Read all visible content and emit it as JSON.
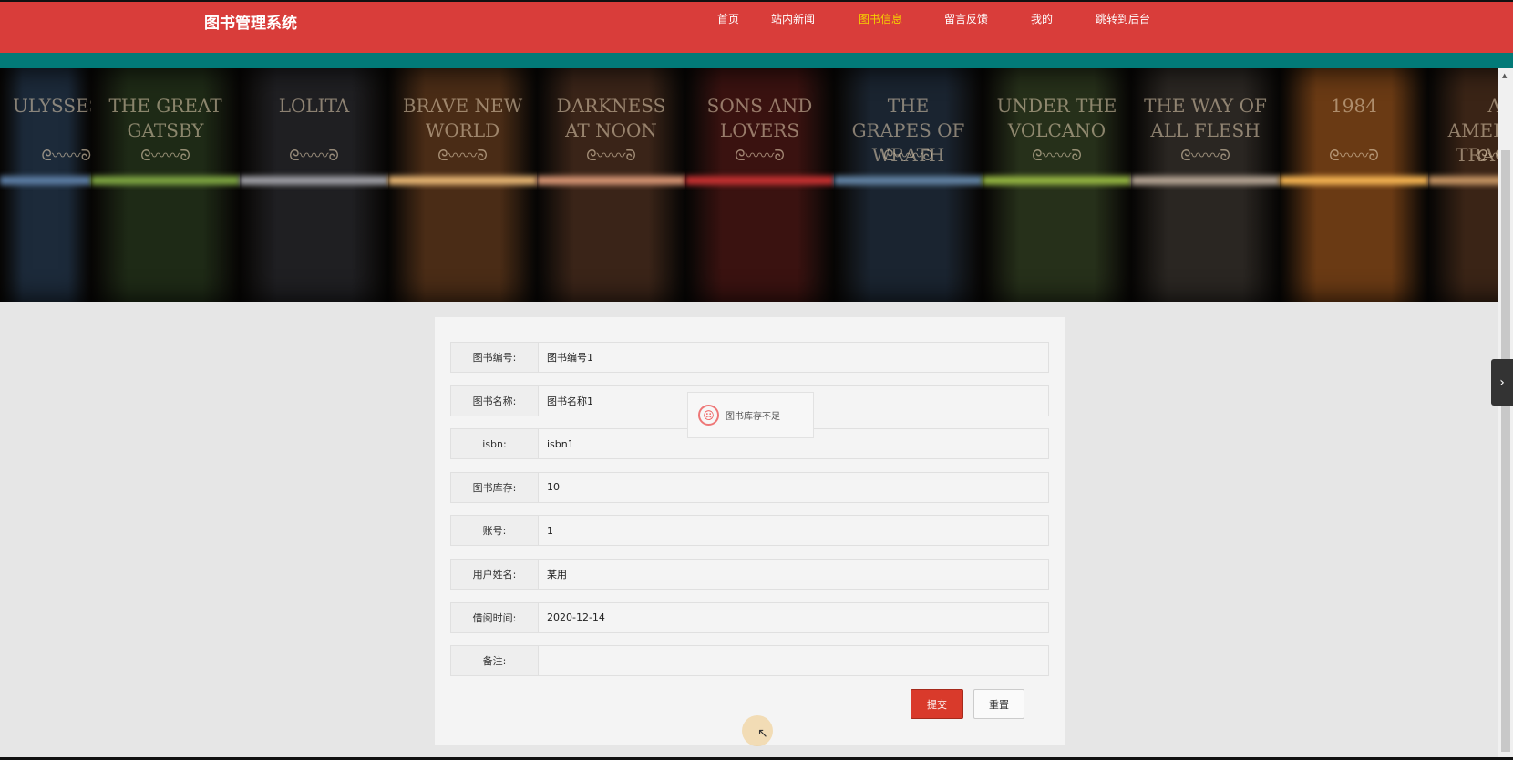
{
  "header": {
    "brand": "图书管理系统",
    "nav": [
      {
        "label": "首页",
        "active": false
      },
      {
        "label": "站内新闻",
        "active": false
      },
      {
        "label": "图书信息",
        "active": true
      },
      {
        "label": "留言反馈",
        "active": false
      },
      {
        "label": "我的",
        "active": false
      },
      {
        "label": "跳转到后台",
        "active": false
      }
    ],
    "colors": {
      "header": "#d93d3a",
      "strip": "#027a78",
      "active": "#f5d000"
    }
  },
  "banner": {
    "books": [
      {
        "title": "ULYSSES",
        "color": "#1c2a3a",
        "band": "#5a7aa0"
      },
      {
        "title": "THE GREAT GATSBY",
        "color": "#1e2a16",
        "band": "#7aa040"
      },
      {
        "title": "LOLITA",
        "color": "#1f1f22",
        "band": "#9a9aa0"
      },
      {
        "title": "BRAVE NEW WORLD",
        "color": "#4a2c16",
        "band": "#e0b070"
      },
      {
        "title": "DARKNESS AT NOON",
        "color": "#3a2418",
        "band": "#d09070"
      },
      {
        "title": "SONS AND LOVERS",
        "color": "#3a1210",
        "band": "#c03030"
      },
      {
        "title": "THE GRAPES OF WRATH",
        "color": "#1a2430",
        "band": "#6080a0"
      },
      {
        "title": "UNDER THE VOLCANO",
        "color": "#26301a",
        "band": "#90b040"
      },
      {
        "title": "THE WAY OF ALL FLESH",
        "color": "#2a2622",
        "band": "#b0a090"
      },
      {
        "title": "1984",
        "color": "#6a3a14",
        "band": "#f0b050"
      },
      {
        "title": "AN AMERICAN TRAGEDY",
        "color": "#3a2416",
        "band": "#c09060"
      }
    ]
  },
  "form": {
    "fields": [
      {
        "label": "图书编号:",
        "value": "图书编号1"
      },
      {
        "label": "图书名称:",
        "value": "图书名称1"
      },
      {
        "label": "isbn:",
        "value": "isbn1"
      },
      {
        "label": "图书库存:",
        "value": "10"
      },
      {
        "label": "账号:",
        "value": "1"
      },
      {
        "label": "用户姓名:",
        "value": "某用"
      },
      {
        "label": "借阅时间:",
        "value": "2020-12-14"
      },
      {
        "label": "备注:",
        "value": ""
      }
    ],
    "submit": "提交",
    "reset": "重置"
  },
  "toast": {
    "icon": "sad-face-icon",
    "message": "图书库存不足"
  }
}
